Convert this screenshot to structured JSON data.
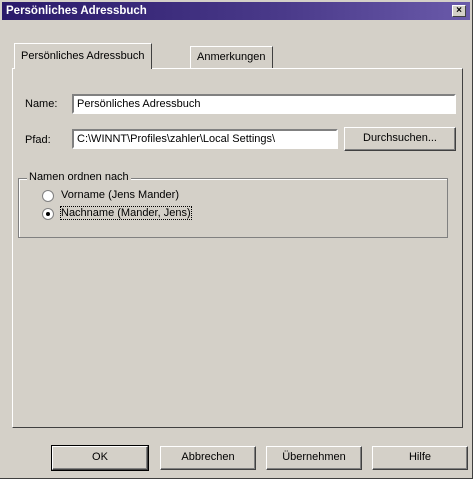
{
  "window": {
    "title": "Persönliches Adressbuch",
    "close_glyph": "×"
  },
  "tabs": [
    {
      "label": "Persönliches Adressbuch",
      "active": true
    },
    {
      "label": "Anmerkungen",
      "active": false
    }
  ],
  "form": {
    "name_label": "Name:",
    "name_value": "Persönliches Adressbuch",
    "path_label": "Pfad:",
    "path_value": "C:\\WINNT\\Profiles\\zahler\\Local Settings\\",
    "browse_label": "Durchsuchen..."
  },
  "sort_group": {
    "title": "Namen ordnen nach",
    "options": [
      {
        "label": "Vorname (Jens Mander)",
        "checked": false
      },
      {
        "label": "Nachname (Mander, Jens)",
        "checked": true
      }
    ]
  },
  "footer": {
    "ok": "OK",
    "cancel": "Abbrechen",
    "apply": "Übernehmen",
    "help": "Hilfe"
  }
}
